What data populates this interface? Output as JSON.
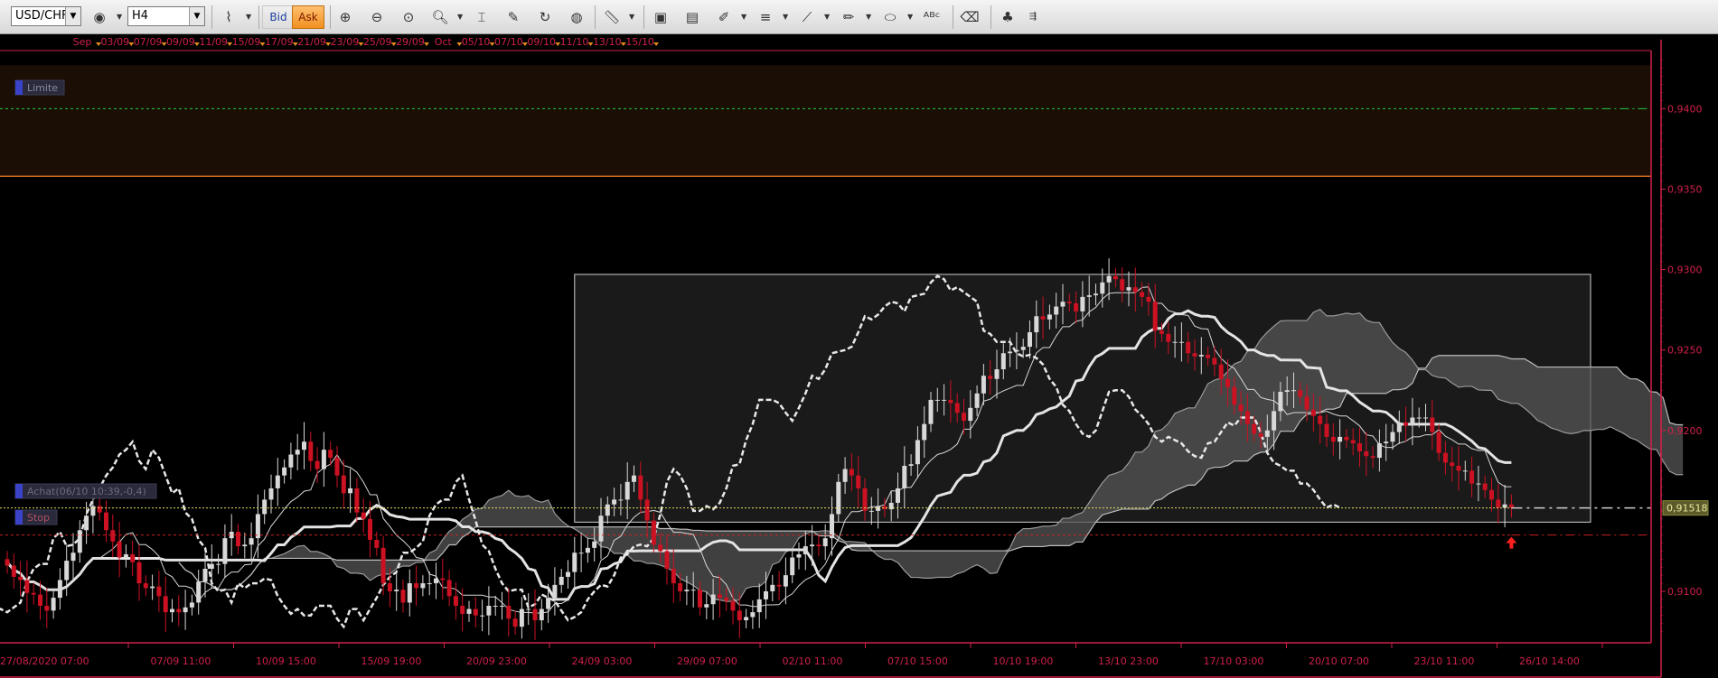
{
  "toolbar": {
    "symbol": "USD/CHF",
    "timeframe": "H4",
    "bid_label": "Bid",
    "ask_label": "Ask"
  },
  "chart_data": {
    "type": "candlestick",
    "instrument": "USD/CHF",
    "timeframe": "H4",
    "price_axis_ticks": [
      "0,9400",
      "0,9350",
      "0,9300",
      "0,9250",
      "0,9200",
      "0,9150",
      "0,9100"
    ],
    "current_price_label": "0,91518",
    "top_date_ticks": [
      "Sep",
      "03/09",
      "07/09",
      "09/09",
      "11/09",
      "15/09",
      "17/09",
      "21/09",
      "23/09",
      "25/09",
      "29/09",
      "Oct",
      "05/10",
      "07/10",
      "09/10",
      "11/10",
      "13/10",
      "15/10"
    ],
    "bottom_time_ticks": [
      "27/08/2020 07:00",
      "07/09 11:00",
      "10/09 15:00",
      "15/09 19:00",
      "20/09 23:00",
      "24/09 03:00",
      "29/09 07:00",
      "02/10 11:00",
      "07/10 15:00",
      "10/10 19:00",
      "13/10 23:00",
      "17/10 03:00",
      "20/10 07:00",
      "23/10 11:00",
      "26/10 14:00"
    ],
    "order_labels": {
      "limit": "Limite",
      "buy": "Achat(06/10 10:39,-0,4)",
      "stop": "Stop"
    },
    "levels": {
      "limit": 0.94,
      "limit_zone": [
        0.9358,
        0.9427
      ],
      "entry": 0.91518,
      "stop": 0.9135,
      "current": 0.91518
    },
    "ylim": [
      0.9068,
      0.9435
    ],
    "highlight_box": {
      "from_bar": 86,
      "to_bar": 240,
      "price_range": [
        0.9143,
        0.9297
      ]
    },
    "colors": {
      "up_candle": "#d8d8d8",
      "down_candle": "#cc1122",
      "axis": "#d0204a",
      "limit_line": "#22cc44",
      "entry_line": "#e0e060",
      "stop_line": "#cc2020",
      "cloud": "#555555"
    },
    "series": [
      {
        "name": "close",
        "values": [
          0.9116,
          0.9109,
          0.9107,
          0.9099,
          0.9098,
          0.9091,
          0.9088,
          0.9096,
          0.9107,
          0.9119,
          0.9124,
          0.9138,
          0.9147,
          0.9153,
          0.9149,
          0.9138,
          0.9131,
          0.9121,
          0.9123,
          0.9118,
          0.9105,
          0.9102,
          0.9103,
          0.9097,
          0.9087,
          0.9089,
          0.9087,
          0.909,
          0.9093,
          0.9106,
          0.9114,
          0.9117,
          0.9117,
          0.9133,
          0.9137,
          0.9128,
          0.9129,
          0.9133,
          0.9148,
          0.9157,
          0.9164,
          0.9172,
          0.9177,
          0.9185,
          0.9188,
          0.9193,
          0.9181,
          0.9176,
          0.9188,
          0.9183,
          0.9172,
          0.9161,
          0.9164,
          0.9149,
          0.9145,
          0.9132,
          0.9127,
          0.9105,
          0.91,
          0.9101,
          0.9093,
          0.9105,
          0.9102,
          0.9105,
          0.9105,
          0.9108,
          0.9107,
          0.9097,
          0.9091,
          0.9086,
          0.9089,
          0.9085,
          0.9085,
          0.9091,
          0.9091,
          0.9091,
          0.9083,
          0.9078,
          0.9089,
          0.9089,
          0.9082,
          0.9089,
          0.9096,
          0.9104,
          0.9109,
          0.9112,
          0.9124,
          0.9124,
          0.9127,
          0.9131,
          0.9147,
          0.9154,
          0.9157,
          0.9157,
          0.9168,
          0.9172,
          0.9157,
          0.9144,
          0.9129,
          0.9125,
          0.9114,
          0.9105,
          0.91,
          0.9101,
          0.9101,
          0.909,
          0.9092,
          0.9098,
          0.9096,
          0.9094,
          0.9088,
          0.9082,
          0.9084,
          0.9087,
          0.9095,
          0.91,
          0.9104,
          0.9103,
          0.911,
          0.9121,
          0.9123,
          0.9128,
          0.9129,
          0.9128,
          0.9133,
          0.9148,
          0.9168,
          0.9176,
          0.9172,
          0.9164,
          0.915,
          0.915,
          0.9153,
          0.9151,
          0.9155,
          0.9164,
          0.9178,
          0.9179,
          0.9194,
          0.9204,
          0.9219,
          0.9219,
          0.9219,
          0.9217,
          0.9211,
          0.9206,
          0.9214,
          0.9223,
          0.9234,
          0.9232,
          0.9238,
          0.9248,
          0.9249,
          0.925,
          0.9252,
          0.9261,
          0.9271,
          0.9269,
          0.9272,
          0.9277,
          0.928,
          0.9279,
          0.9274,
          0.9283,
          0.9284,
          0.9285,
          0.9292,
          0.9296,
          0.9294,
          0.9287,
          0.9289,
          0.9286,
          0.9283,
          0.928,
          0.9262,
          0.926,
          0.9255,
          0.9255,
          0.9255,
          0.9248,
          0.9246,
          0.9247,
          0.9245,
          0.9241,
          0.9232,
          0.9227,
          0.9216,
          0.9212,
          0.9204,
          0.9198,
          0.9196,
          0.92,
          0.9212,
          0.9224,
          0.9225,
          0.9225,
          0.9221,
          0.9213,
          0.9209,
          0.9204,
          0.9196,
          0.9193,
          0.9196,
          0.9194,
          0.9192,
          0.9187,
          0.9184,
          0.9183,
          0.9192,
          0.9193,
          0.9199,
          0.9205,
          0.9203,
          0.9208,
          0.9208,
          0.9208,
          0.9199,
          0.9186,
          0.918,
          0.9178,
          0.9175,
          0.9175,
          0.9167,
          0.9167,
          0.9163,
          0.9157,
          0.9152,
          0.9154,
          0.9152
        ]
      }
    ]
  }
}
